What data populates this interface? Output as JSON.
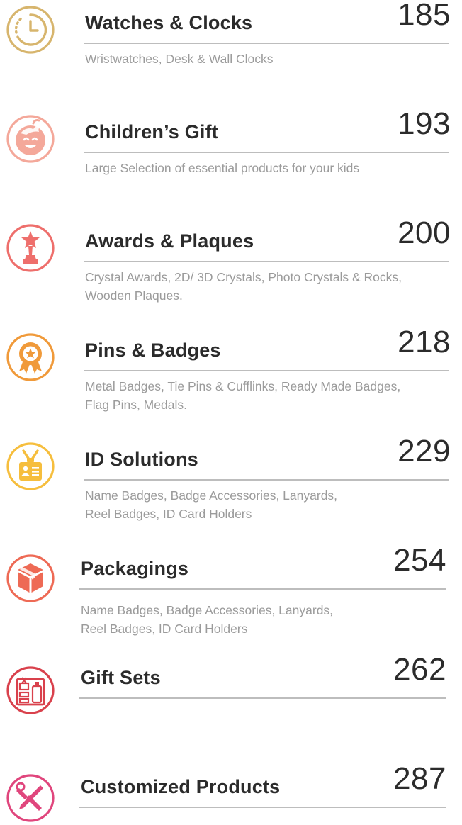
{
  "entries": [
    {
      "title": "Watches & Clocks",
      "page": "185",
      "desc": [
        "Wristwatches, Desk & Wall Clocks"
      ],
      "icon": "clock-icon",
      "color": "#d7b56d"
    },
    {
      "title": "Children’s Gift",
      "page": "193",
      "desc": [
        "Large Selection of essential products for your kids"
      ],
      "icon": "child-face-icon",
      "color": "#f4a89a"
    },
    {
      "title": "Awards & Plaques",
      "page": "200",
      "desc": [
        "Crystal Awards, 2D/ 3D Crystals, Photo Crystals & Rocks,",
        "Wooden Plaques."
      ],
      "icon": "trophy-icon",
      "color": "#ee6f6c"
    },
    {
      "title": "Pins & Badges",
      "page": "218",
      "desc": [
        "Metal Badges, Tie Pins & Cufflinks, Ready Made Badges,",
        "Flag Pins, Medals."
      ],
      "icon": "rosette-badge-icon",
      "color": "#f09a3a"
    },
    {
      "title": "ID Solutions",
      "page": "229",
      "desc": [
        "Name Badges, Badge Accessories, Lanyards,",
        "Reel Badges, ID Card Holders"
      ],
      "icon": "id-card-icon",
      "color": "#f6be3d"
    },
    {
      "title": "Packagings",
      "page": "254",
      "desc": [
        "Name Badges, Badge Accessories, Lanyards,",
        "Reel Badges, ID Card Holders"
      ],
      "icon": "box-icon",
      "color": "#ee6a55"
    },
    {
      "title": "Gift Sets",
      "page": "262",
      "desc": [],
      "icon": "gift-set-icon",
      "color": "#d9414c"
    },
    {
      "title": "Customized Products",
      "page": "287",
      "desc": [],
      "icon": "tools-icon",
      "color": "#e0467d"
    }
  ]
}
